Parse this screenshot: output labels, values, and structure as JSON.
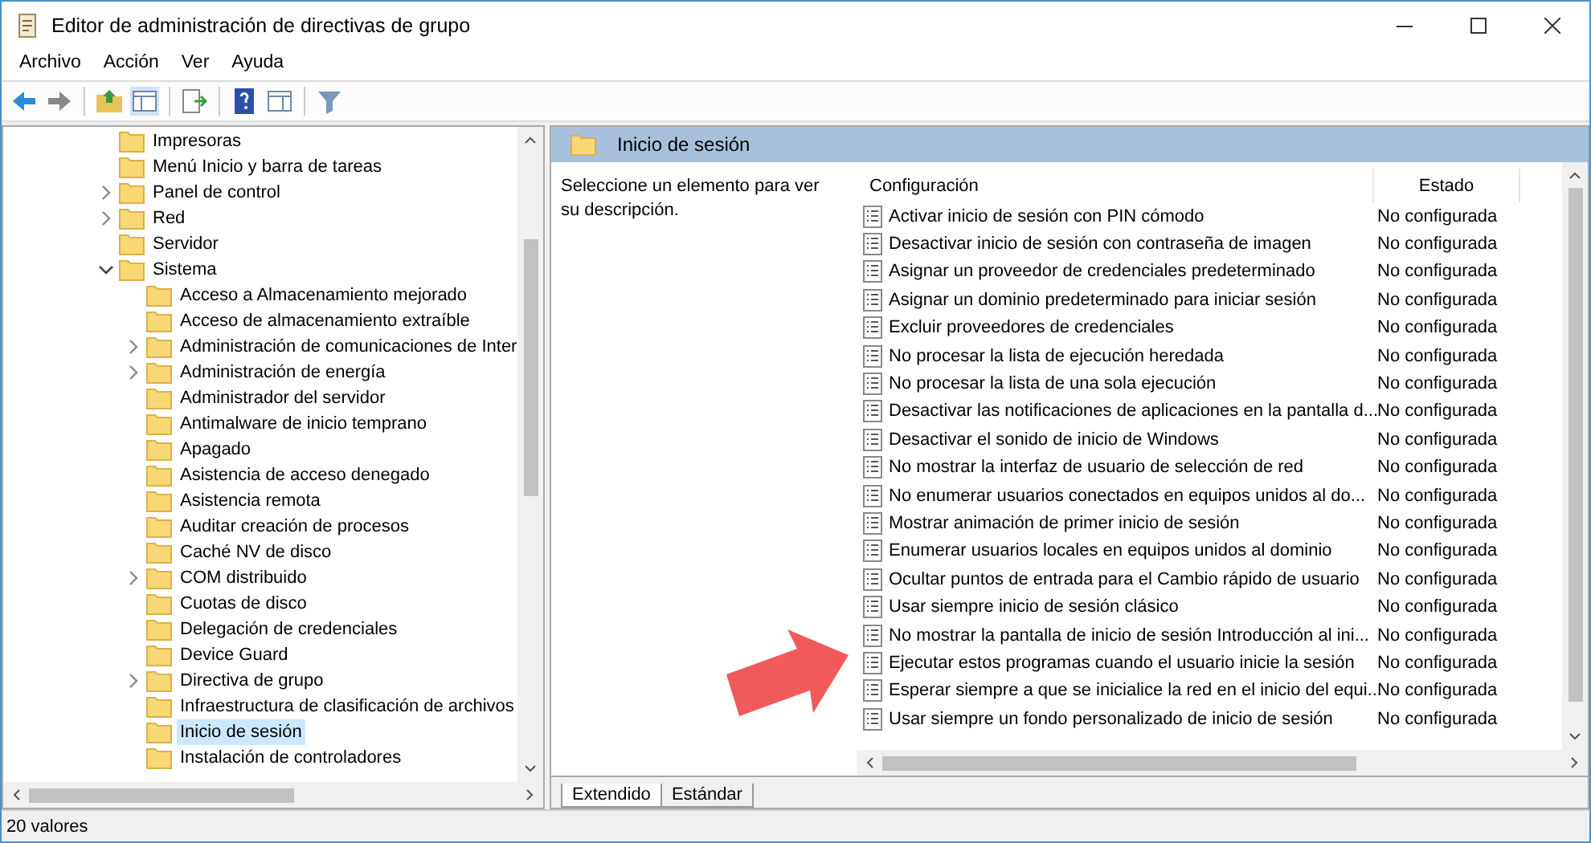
{
  "window": {
    "title": "Editor de administración de directivas de grupo"
  },
  "menu": [
    "Archivo",
    "Acción",
    "Ver",
    "Ayuda"
  ],
  "tree": [
    {
      "label": "Impresoras",
      "expandable": false,
      "selected": false
    },
    {
      "label": "Menú Inicio y barra de tareas",
      "expandable": false,
      "selected": false
    },
    {
      "label": "Panel de control",
      "expandable": true,
      "expanded": false,
      "selected": false
    },
    {
      "label": "Red",
      "expandable": true,
      "expanded": false,
      "selected": false
    },
    {
      "label": "Servidor",
      "expandable": false,
      "selected": false
    },
    {
      "label": "Sistema",
      "expandable": true,
      "expanded": true,
      "selected": false,
      "children": [
        {
          "label": "Acceso a Almacenamiento mejorado",
          "expandable": false,
          "selected": false
        },
        {
          "label": "Acceso de almacenamiento extraíble",
          "expandable": false,
          "selected": false
        },
        {
          "label": "Administración de comunicaciones de Inter",
          "expandable": true,
          "expanded": false,
          "selected": false
        },
        {
          "label": "Administración de energía",
          "expandable": true,
          "expanded": false,
          "selected": false
        },
        {
          "label": "Administrador del servidor",
          "expandable": false,
          "selected": false
        },
        {
          "label": "Antimalware de inicio temprano",
          "expandable": false,
          "selected": false
        },
        {
          "label": "Apagado",
          "expandable": false,
          "selected": false
        },
        {
          "label": "Asistencia de acceso denegado",
          "expandable": false,
          "selected": false
        },
        {
          "label": "Asistencia remota",
          "expandable": false,
          "selected": false
        },
        {
          "label": "Auditar creación de procesos",
          "expandable": false,
          "selected": false
        },
        {
          "label": "Caché NV de disco",
          "expandable": false,
          "selected": false
        },
        {
          "label": "COM distribuido",
          "expandable": true,
          "expanded": false,
          "selected": false
        },
        {
          "label": "Cuotas de disco",
          "expandable": false,
          "selected": false
        },
        {
          "label": "Delegación de credenciales",
          "expandable": false,
          "selected": false
        },
        {
          "label": "Device Guard",
          "expandable": false,
          "selected": false
        },
        {
          "label": "Directiva de grupo",
          "expandable": true,
          "expanded": false,
          "selected": false
        },
        {
          "label": "Infraestructura de clasificación de archivos",
          "expandable": false,
          "selected": false
        },
        {
          "label": "Inicio de sesión",
          "expandable": false,
          "selected": true
        },
        {
          "label": "Instalación de controladores",
          "expandable": false,
          "selected": false
        }
      ]
    }
  ],
  "details": {
    "title": "Inicio de sesión",
    "description": "Seleccione un elemento para ver su descripción.",
    "columns": [
      "Configuración",
      "Estado"
    ],
    "rows": [
      {
        "setting": "Activar inicio de sesión con PIN cómodo",
        "state": "No configurada"
      },
      {
        "setting": "Desactivar inicio de sesión con contraseña de imagen",
        "state": "No configurada"
      },
      {
        "setting": "Asignar un proveedor de credenciales predeterminado",
        "state": "No configurada"
      },
      {
        "setting": "Asignar un dominio predeterminado para iniciar sesión",
        "state": "No configurada"
      },
      {
        "setting": "Excluir proveedores de credenciales",
        "state": "No configurada"
      },
      {
        "setting": "No procesar la lista de ejecución heredada",
        "state": "No configurada"
      },
      {
        "setting": "No procesar la lista de una sola ejecución",
        "state": "No configurada"
      },
      {
        "setting": "Desactivar las notificaciones de aplicaciones en la pantalla d...",
        "state": "No configurada"
      },
      {
        "setting": "Desactivar el sonido de inicio de Windows",
        "state": "No configurada"
      },
      {
        "setting": "No mostrar la interfaz de usuario de selección de red",
        "state": "No configurada"
      },
      {
        "setting": "No enumerar usuarios conectados en equipos unidos al do...",
        "state": "No configurada"
      },
      {
        "setting": "Mostrar animación de primer inicio de sesión",
        "state": "No configurada"
      },
      {
        "setting": "Enumerar usuarios locales en equipos unidos al dominio",
        "state": "No configurada"
      },
      {
        "setting": "Ocultar puntos de entrada para el Cambio rápido de usuario",
        "state": "No configurada"
      },
      {
        "setting": "Usar siempre inicio de sesión clásico",
        "state": "No configurada"
      },
      {
        "setting": "No mostrar la pantalla de inicio de sesión Introducción al ini...",
        "state": "No configurada"
      },
      {
        "setting": "Ejecutar estos programas cuando el usuario inicie la sesión",
        "state": "No configurada"
      },
      {
        "setting": "Esperar siempre a que se inicialice la red en el inicio del equi...",
        "state": "No configurada"
      },
      {
        "setting": "Usar siempre un fondo personalizado de inicio de sesión",
        "state": "No configurada"
      }
    ],
    "tabs": [
      {
        "label": "Extendido",
        "selected": true
      },
      {
        "label": "Estándar",
        "selected": false
      }
    ]
  },
  "status_bar": "20 valores"
}
